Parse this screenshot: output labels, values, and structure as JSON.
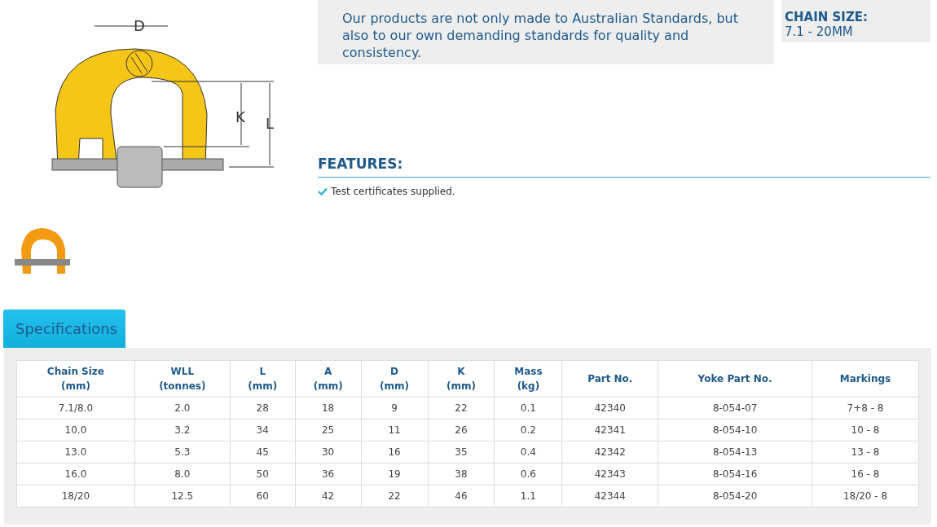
{
  "diagram": {
    "labels": [
      "D",
      "K",
      "L"
    ]
  },
  "intro": "Our products are not only made to Australian Standards, but also to our own demanding standards for quality and consistency.",
  "chain_size": {
    "label": "CHAIN SIZE:",
    "value": "7.1 - 20MM"
  },
  "features": {
    "heading": "FEATURES:",
    "items": [
      "Test certificates supplied."
    ]
  },
  "tabs": [
    {
      "label": "Specifications",
      "selected": true
    }
  ],
  "table": {
    "columns": [
      "Chain Size\n(mm)",
      "WLL\n(tonnes)",
      "L\n(mm)",
      "A\n(mm)",
      "D\n(mm)",
      "K\n(mm)",
      "Mass\n(kg)",
      "Part No.",
      "Yoke Part No.",
      "Markings"
    ],
    "rows": [
      [
        "7.1/8.0",
        "2.0",
        "28",
        "18",
        "9",
        "22",
        "0.1",
        "42340",
        "8-054-07",
        "7+8 - 8"
      ],
      [
        "10.0",
        "3.2",
        "34",
        "25",
        "11",
        "26",
        "0.2",
        "42341",
        "8-054-10",
        "10 - 8"
      ],
      [
        "13.0",
        "5.3",
        "45",
        "30",
        "16",
        "35",
        "0.4",
        "42342",
        "8-054-13",
        "13 - 8"
      ],
      [
        "16.0",
        "8.0",
        "50",
        "36",
        "19",
        "38",
        "0.6",
        "42343",
        "8-054-16",
        "16 - 8"
      ],
      [
        "18/20",
        "12.5",
        "60",
        "42",
        "22",
        "46",
        "1.1",
        "42344",
        "8-054-20",
        "18/20 - 8"
      ]
    ]
  }
}
